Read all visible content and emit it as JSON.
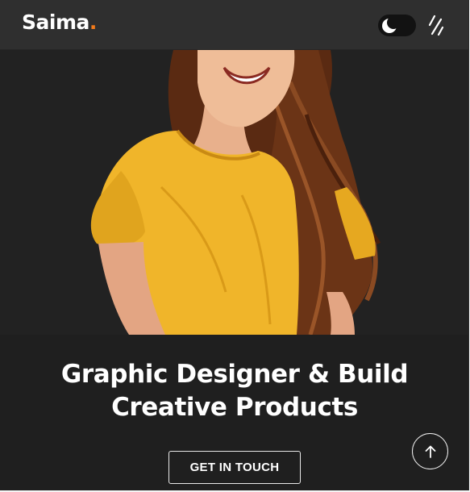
{
  "header": {
    "logo_text": "Saima",
    "logo_dot": ".",
    "theme_toggle_icon": "moon-icon",
    "menu_icon": "menu-slashes-icon"
  },
  "hero": {
    "image_icon": "portrait-photo",
    "headline_line1": "Graphic Designer & Build",
    "headline_line2": "Creative Products",
    "cta_label": "GET IN TOUCH"
  },
  "scroll_top": {
    "icon": "arrow-up-icon"
  },
  "colors": {
    "accent": "#f27a1a",
    "background": "#1f1f1f",
    "header_bg": "#2f2f2f",
    "text": "#ffffff"
  }
}
